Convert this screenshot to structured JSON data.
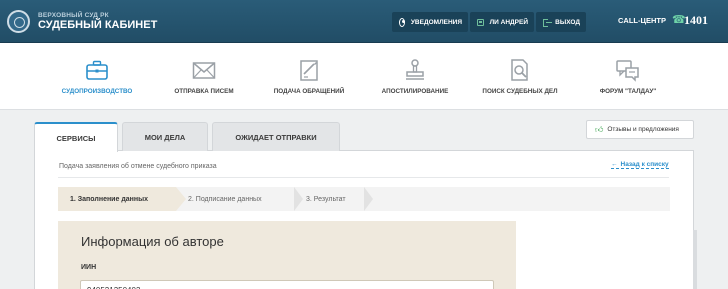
{
  "header": {
    "court_name": "ВЕРХОВНЫЙ СУД РК",
    "cabinet_name": "СУДЕБНЫЙ КАБИНЕТ",
    "buttons": {
      "notifications": "УВЕДОМЛЕНИЯ",
      "user": "ЛИ АНДРЕЙ",
      "exit": "ВЫХОД"
    },
    "callcenter_label": "CALL-ЦЕНТР",
    "phone_number": "1401"
  },
  "nav": {
    "items": [
      {
        "label": "СУДОПРОИЗВОДСТВО",
        "icon": "briefcase-icon",
        "active": true
      },
      {
        "label": "ОТПРАВКА ПИСЕМ",
        "icon": "envelope-icon"
      },
      {
        "label": "ПОДАЧА ОБРАЩЕНИЙ",
        "icon": "document-edit-icon"
      },
      {
        "label": "АПОСТИЛИРОВАНИЕ",
        "icon": "stamp-icon"
      },
      {
        "label": "ПОИСК СУДЕБНЫХ ДЕЛ",
        "icon": "document-search-icon"
      },
      {
        "label": "ФОРУМ \"ТАЛДАУ\"",
        "icon": "chat-icon"
      }
    ]
  },
  "tabs": [
    {
      "label": "СЕРВИСЫ",
      "active": true
    },
    {
      "label": "МОИ ДЕЛА"
    },
    {
      "label": "ОЖИДАЕТ ОТПРАВКИ"
    }
  ],
  "feedback_button": "Отзывы и предложения",
  "breadcrumb": "Подача заявления об отмене судебного приказа",
  "back_link": "Назад к списку",
  "steps": [
    "1. Заполнение данных",
    "2. Подписание данных",
    "3. Результат"
  ],
  "form": {
    "section_title": "Информация об авторе",
    "iin_label": "ИИН",
    "iin_value": "940521350403"
  },
  "colors": {
    "header_bg": "#245670",
    "accent_blue": "#2b8fcb",
    "step_active_bg": "#efe9dd",
    "icon_green": "#6fbf9b"
  }
}
